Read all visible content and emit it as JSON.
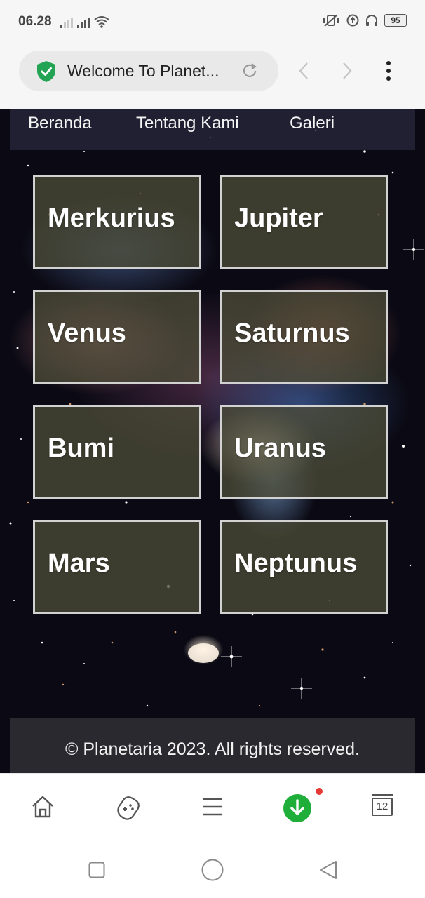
{
  "status_bar": {
    "time": "06.28",
    "battery": "95"
  },
  "browser": {
    "url_title": "Welcome To Planet..."
  },
  "nav": {
    "links": [
      "Beranda",
      "Tentang Kami",
      "Galeri"
    ]
  },
  "planets": [
    "Merkurius",
    "Jupiter",
    "Venus",
    "Saturnus",
    "Bumi",
    "Uranus",
    "Mars",
    "Neptunus"
  ],
  "footer": {
    "text": "© Planetaria 2023. All rights reserved."
  },
  "toolbar": {
    "tab_count": "12",
    "icons": [
      "home-icon",
      "game-controller-icon",
      "menu-icon",
      "download-icon",
      "tabs-icon"
    ]
  },
  "colors": {
    "card_border": "#d2d2d2",
    "download_green": "#1fae3a",
    "notification_red": "#e53935",
    "shield_green": "#23a455"
  }
}
